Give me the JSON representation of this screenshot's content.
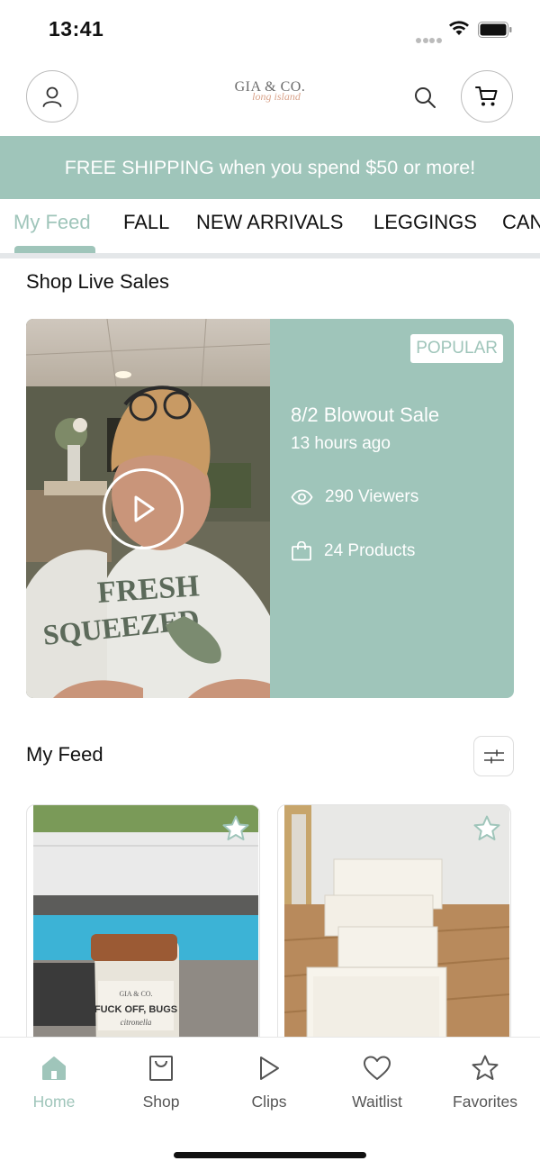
{
  "status_bar": {
    "time": "13:41"
  },
  "header": {
    "logo_text": "GIA & CO.",
    "logo_subtext": "long island"
  },
  "banner": {
    "text": "FREE SHIPPING when you spend $50 or more!"
  },
  "tabs": [
    {
      "label": "My Feed",
      "active": true
    },
    {
      "label": "FALL",
      "active": false
    },
    {
      "label": "NEW ARRIVALS",
      "active": false
    },
    {
      "label": "LEGGINGS",
      "active": false
    },
    {
      "label": "CAN",
      "active": false
    }
  ],
  "live_section": {
    "title": "Shop Live Sales",
    "card": {
      "badge": "POPULAR",
      "title": "8/2 Blowout Sale",
      "time": "13 hours ago",
      "viewers": "290 Viewers",
      "products": "24 Products",
      "shirt_line1": "FRESH",
      "shirt_line2": "SQUEEZED"
    }
  },
  "feed_section": {
    "title": "My Feed",
    "products": [
      {
        "jar_brand": "GIA & CO.",
        "jar_label": "FUCK OFF, BUGS",
        "jar_sub": "citronella"
      },
      {
        "jar_brand": "",
        "jar_label": "",
        "jar_sub": ""
      }
    ]
  },
  "tab_bar": [
    {
      "label": "Home",
      "icon": "home-icon",
      "active": true
    },
    {
      "label": "Shop",
      "icon": "shopping-bag-icon",
      "active": false
    },
    {
      "label": "Clips",
      "icon": "play-icon",
      "active": false
    },
    {
      "label": "Waitlist",
      "icon": "heart-icon",
      "active": false
    },
    {
      "label": "Favorites",
      "icon": "star-icon",
      "active": false
    }
  ],
  "colors": {
    "accent": "#9fc5ba",
    "text": "#111111",
    "muted": "#555555"
  }
}
